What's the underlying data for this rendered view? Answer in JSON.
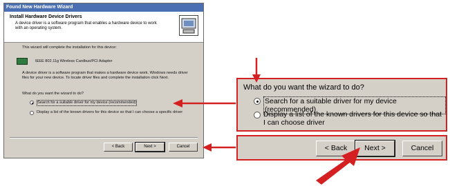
{
  "wizard": {
    "title_bar": "Found New Hardware Wizard",
    "header_title": "Install Hardware Device Drivers",
    "header_desc": "A device driver is a software program that enables a hardware device to work with an operating system.",
    "intro": "This wizard will complete the installation for this device:",
    "device_name": "IEEE 802.11g Wireless Cardbus/PCI Adapter",
    "paragraph": "A device driver is a software program that makes a hardware device work. Windows needs driver files for your new device. To locate driver files and complete the installation click Next.",
    "question": "What do you want the wizard to do?",
    "option_search": "Search for a suitable driver for my device (recommended)",
    "option_display": "Display a list of the known drivers for this device so that I can choose a specific driver",
    "back_label": "< Back",
    "next_label": "Next >",
    "cancel_label": "Cancel"
  },
  "zoom": {
    "question": "What do you want the wizard to do?",
    "option_search": "Search for a suitable driver for my device (recommended)",
    "option_display": "Display a list of the known drivers for this device so that I can choose driver",
    "back_label": "< Back",
    "next_label": "Next >",
    "cancel_label": "Cancel"
  },
  "colors": {
    "annotation_red": "#d42020",
    "dialog_gray": "#d4d0c8",
    "titlebar_blue": "#4a6fb3"
  },
  "icons": [
    "hardware-wizard-icon",
    "network-card-icon",
    "radio-selected",
    "radio-unselected",
    "annotation-arrow"
  ]
}
